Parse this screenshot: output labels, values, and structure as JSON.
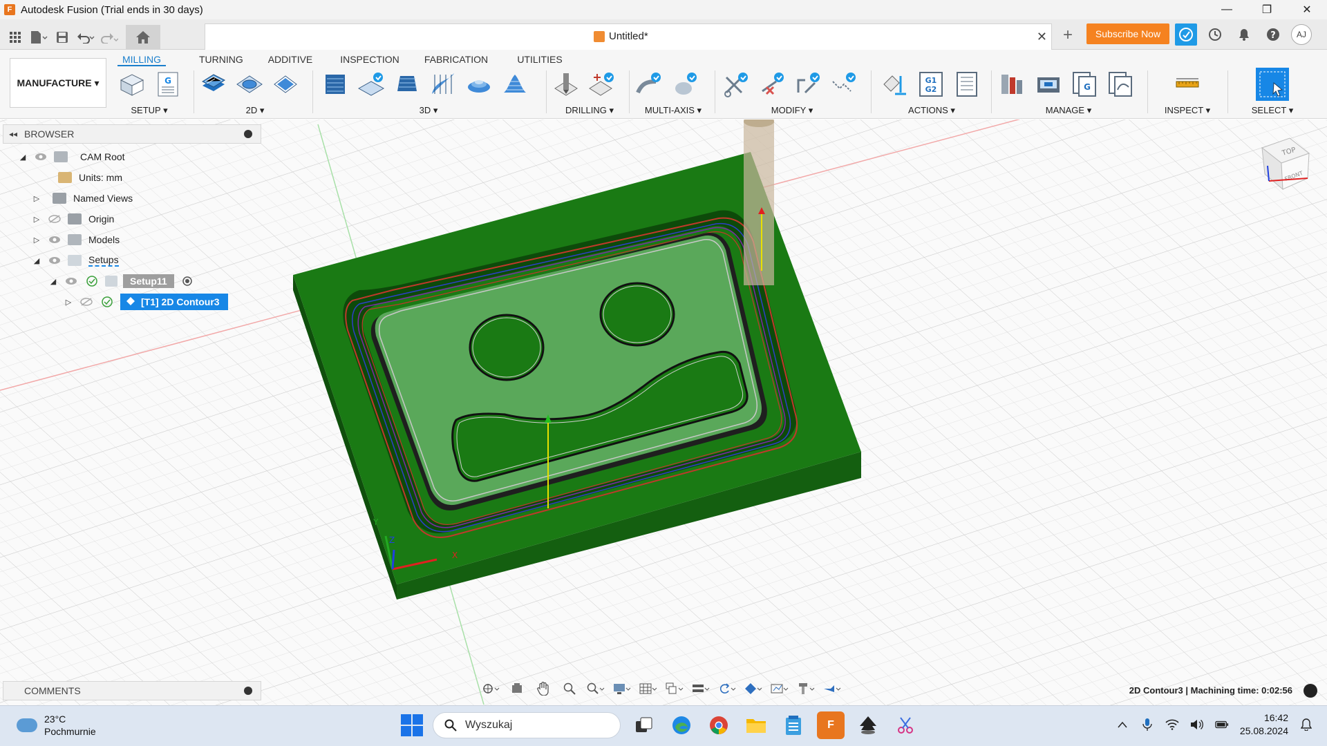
{
  "window": {
    "title": "Autodesk Fusion (Trial ends in 30 days)",
    "logo_letter": "F",
    "controls": [
      "—",
      "❐",
      "✕"
    ]
  },
  "document_tab": {
    "name": "Untitled*",
    "close": "✕"
  },
  "header": {
    "subscribe_label": "Subscribe Now",
    "avatar_initials": "AJ",
    "plus": "+"
  },
  "workspace": {
    "label": "MANUFACTURE ▾"
  },
  "ribbon": {
    "tabs": [
      "MILLING",
      "TURNING",
      "ADDITIVE",
      "INSPECTION",
      "FABRICATION",
      "UTILITIES"
    ],
    "groups": [
      "SETUP ▾",
      "2D ▾",
      "3D ▾",
      "DRILLING ▾",
      "MULTI-AXIS ▾",
      "MODIFY ▾",
      "ACTIONS ▾",
      "MANAGE ▾",
      "INSPECT ▾",
      "SELECT ▾"
    ],
    "g1g2_text": [
      "G1",
      "G2"
    ]
  },
  "browser": {
    "title": "BROWSER",
    "items": [
      "CAM Root",
      "Units: mm",
      "Named Views",
      "Origin",
      "Models",
      "Setups",
      "Setup11",
      "[T1] 2D Contour3"
    ]
  },
  "viewcube": {
    "top": "TOP",
    "front": "FRONT"
  },
  "comments": {
    "title": "COMMENTS"
  },
  "status": {
    "text": "2D Contour3 | Machining time: 0:02:56"
  },
  "taskbar": {
    "temperature": "23°C",
    "weather": "Pochmurnie",
    "search_placeholder": "Wyszukaj",
    "time": "16:42",
    "date": "25.08.2024",
    "fusion_letter": "F"
  },
  "colors": {
    "accent": "#1787e6",
    "subscribe": "#f58220",
    "stock_green": "#1a7a14",
    "pocket_green": "#5aa85a",
    "toolpath_red": "#c0392b",
    "toolpath_blue": "#2e3fc9"
  }
}
